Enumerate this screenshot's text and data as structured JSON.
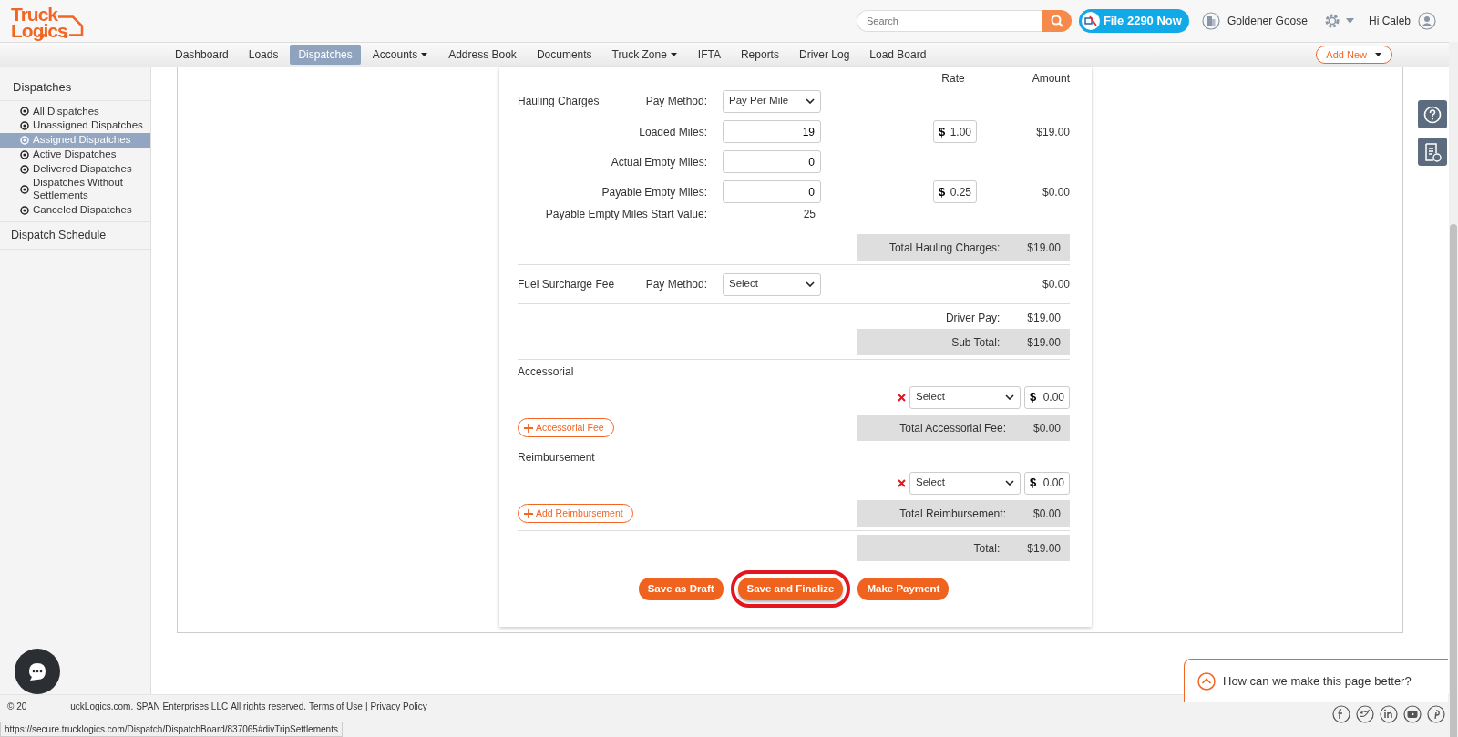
{
  "header": {
    "logo": [
      "Truck",
      "Logics"
    ],
    "search": {
      "placeholder": "Search"
    },
    "file_button": "File 2290 Now",
    "company": "Goldener Goose",
    "greeting": "Hi Caleb"
  },
  "nav": [
    {
      "label": "Dashboard",
      "selected": false,
      "dropdown": false
    },
    {
      "label": "Loads",
      "selected": false,
      "dropdown": false
    },
    {
      "label": "Dispatches",
      "selected": true,
      "dropdown": false
    },
    {
      "label": "Accounts",
      "selected": false,
      "dropdown": true
    },
    {
      "label": "Address Book",
      "selected": false,
      "dropdown": false
    },
    {
      "label": "Documents",
      "selected": false,
      "dropdown": false
    },
    {
      "label": "Truck Zone",
      "selected": false,
      "dropdown": true
    },
    {
      "label": "IFTA",
      "selected": false,
      "dropdown": false
    },
    {
      "label": "Reports",
      "selected": false,
      "dropdown": false
    },
    {
      "label": "Driver Log",
      "selected": false,
      "dropdown": false
    },
    {
      "label": "Load Board",
      "selected": false,
      "dropdown": false
    }
  ],
  "add_new": "Add New",
  "sidebar": {
    "title": "Dispatches",
    "items": [
      {
        "label": "All Dispatches",
        "selected": false
      },
      {
        "label": "Unassigned Dispatches",
        "selected": false
      },
      {
        "label": "Assigned Dispatches",
        "selected": true
      },
      {
        "label": "Active Dispatches",
        "selected": false
      },
      {
        "label": "Delivered Dispatches",
        "selected": false
      },
      {
        "label": "Dispatches Without Settlements",
        "selected": false
      },
      {
        "label": "Canceled Dispatches",
        "selected": false
      }
    ],
    "schedule": "Dispatch Schedule"
  },
  "settlement": {
    "columns": [
      "Rate",
      "Amount"
    ],
    "rows": [
      {
        "kind": "method",
        "section": "Hauling Charges",
        "label": "Pay Method:",
        "value": "Pay Per Mile"
      },
      {
        "kind": "miles",
        "label": "Loaded Miles:",
        "value": "19",
        "rate": {
          "symbol": "$",
          "value": "1.00"
        },
        "amount": "$19.00"
      },
      {
        "kind": "miles",
        "label": "Actual Empty Miles:",
        "value": "0"
      },
      {
        "kind": "miles",
        "label": "Payable Empty Miles:",
        "value": "0",
        "rate": {
          "symbol": "$",
          "value": "0.25"
        },
        "amount": "$0.00"
      },
      {
        "kind": "info",
        "label": "Payable Empty Miles Start Value:",
        "value": "25"
      },
      {
        "kind": "total",
        "label": "Total Hauling Charges:",
        "amount": "$19.00"
      },
      {
        "kind": "divider"
      },
      {
        "kind": "method",
        "section": "Fuel Surcharge Fee",
        "label": "Pay Method:",
        "value": "Select",
        "amount": "$0.00"
      },
      {
        "kind": "divider"
      },
      {
        "kind": "summary",
        "label": "Driver Pay:",
        "amount": "$19.00"
      },
      {
        "kind": "total",
        "label": "Sub Total:",
        "amount": "$19.00"
      },
      {
        "kind": "divider"
      },
      {
        "kind": "section",
        "label": "Accessorial"
      },
      {
        "kind": "charge",
        "value": "Select",
        "rate": {
          "symbol": "$",
          "value": "0.00"
        }
      },
      {
        "kind": "add",
        "button": "Accessorial Fee",
        "label": "Total Accessorial Fee:",
        "amount": "$0.00"
      },
      {
        "kind": "divider"
      },
      {
        "kind": "section",
        "label": "Reimbursement"
      },
      {
        "kind": "charge",
        "value": "Select",
        "rate": {
          "symbol": "$",
          "value": "0.00"
        }
      },
      {
        "kind": "add",
        "button": "Add Reimbursement",
        "label": "Total Reimbursement:",
        "amount": "$0.00"
      },
      {
        "kind": "divider"
      },
      {
        "kind": "total",
        "label": "Total:",
        "amount": "$19.00"
      }
    ],
    "buttons": [
      {
        "label": "Save as Draft",
        "highlighted": false
      },
      {
        "label": "Save and Finalize",
        "highlighted": true
      },
      {
        "label": "Make Payment",
        "highlighted": false
      }
    ]
  },
  "feedback": "How can we make this page better?",
  "footer": {
    "copyright_start": "© 20",
    "copyright_rest": "uckLogics.com.",
    "company_link": "SPAN Enterprises LLC",
    "rights": "All rights reserved.",
    "terms": "Terms of Use",
    "separator": "|",
    "privacy": "Privacy Policy"
  },
  "status_url": "https://secure.trucklogics.com/Dispatch/DispatchBoard/837065#divTripSettlements"
}
